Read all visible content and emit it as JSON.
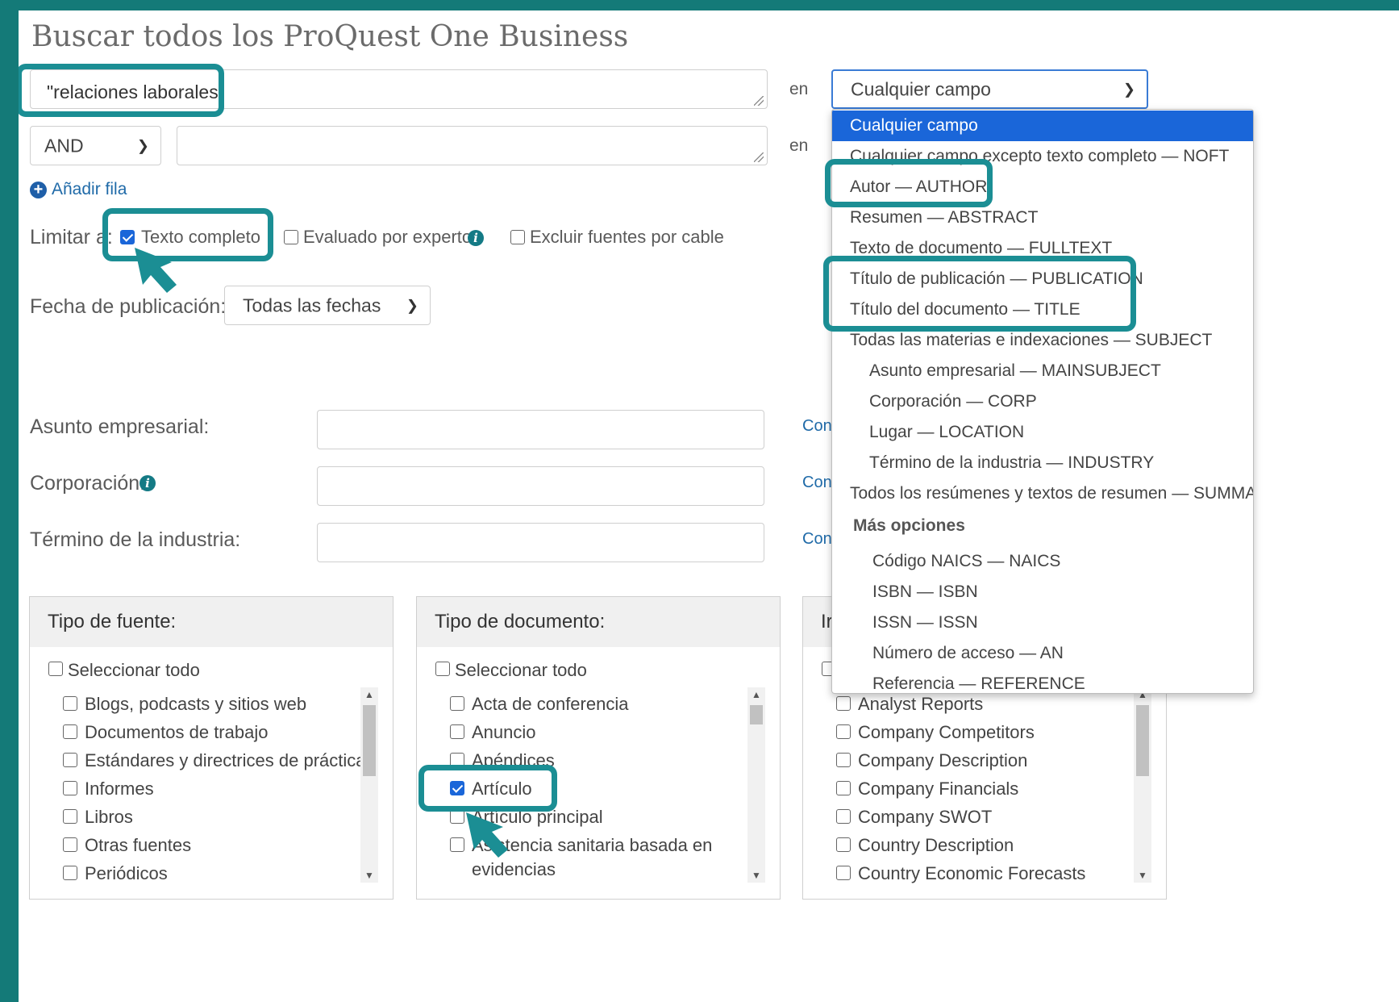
{
  "page_title": "Buscar todos los ProQuest One Business",
  "row1": {
    "query": "\"relaciones laborales\"",
    "en_label": "en",
    "field_select": "Cualquier campo"
  },
  "row2": {
    "operator": "AND",
    "query": "",
    "en_label": "en"
  },
  "add_row": "Añadir fila",
  "limit": {
    "label": "Limitar a:",
    "options": [
      {
        "label": "Texto completo",
        "checked": true
      },
      {
        "label": "Evaluado por expertos",
        "checked": false
      },
      {
        "label": "Excluir fuentes por cable",
        "checked": false
      }
    ]
  },
  "pub_date": {
    "label": "Fecha de publicación:",
    "value": "Todas las fechas"
  },
  "fields": [
    {
      "label": "Asunto empresarial:",
      "link": "Con"
    },
    {
      "label": "Corporación:",
      "link": "Con"
    },
    {
      "label": "Término de la industria:",
      "link": "Con"
    }
  ],
  "source_type": {
    "title": "Tipo de fuente:",
    "select_all": "Seleccionar todo",
    "items": [
      "Blogs, podcasts y sitios web",
      "Documentos de trabajo",
      "Estándares y directrices de prácticas",
      "Informes",
      "Libros",
      "Otras fuentes",
      "Periódicos"
    ]
  },
  "doc_type": {
    "title": "Tipo de documento:",
    "select_all": "Seleccionar todo",
    "items": [
      "Acta de conferencia",
      "Anuncio",
      "Apéndices",
      "Artículo",
      "Artículo principal",
      "Asistencia sanitaria basada en",
      "evidencias"
    ],
    "checked": "Artículo"
  },
  "third_box": {
    "title_fragment": "Ir",
    "items": [
      "Analyst Reports",
      "Company Competitors",
      "Company Description",
      "Company Financials",
      "Company SWOT",
      "Country Description",
      "Country Economic Forecasts"
    ]
  },
  "field_dropdown": {
    "options": [
      "Cualquier campo",
      "Cualquier campo excepto texto completo — NOFT",
      "Autor — AUTHOR",
      "Resumen — ABSTRACT",
      "Texto de documento — FULLTEXT",
      "Título de publicación — PUBLICATION",
      "Título del documento — TITLE",
      "Todas las materias e indexaciones — SUBJECT",
      "Asunto empresarial — MAINSUBJECT",
      "Corporación — CORP",
      "Lugar — LOCATION",
      "Término de la industria — INDUSTRY",
      "Todos los resúmenes y textos de resumen — SUMMARY"
    ],
    "more_header": "Más opciones",
    "more": [
      "Código NAICS — NAICS",
      "ISBN — ISBN",
      "ISSN — ISSN",
      "Número de acceso — AN",
      "Referencia — REFERENCE"
    ],
    "selected": "Cualquier campo"
  },
  "colors": {
    "accent": "#1b8e94",
    "background": "#147a78",
    "selected": "#1a66d9",
    "link": "#1f6aa8"
  },
  "icons": [
    "plus-circle-icon",
    "info-icon",
    "chevron-down-icon",
    "pointer-arrow-icon",
    "resize-grip-icon",
    "scroll-up-icon",
    "scroll-down-icon"
  ]
}
